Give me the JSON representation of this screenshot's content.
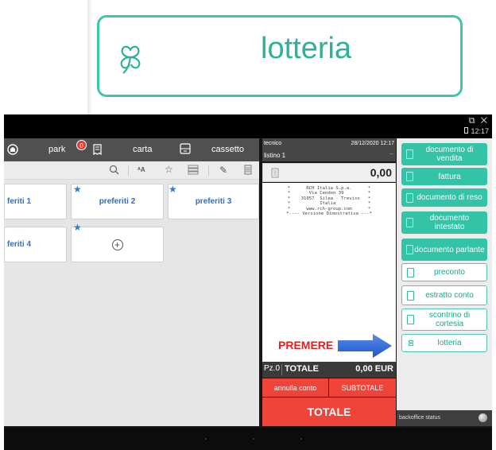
{
  "zoom": {
    "label": "lotteria"
  },
  "topbar": {
    "park": "park",
    "carta": "carta",
    "cassetto": "cassetto",
    "badge": "0"
  },
  "status": {
    "clock": "12:17",
    "window_icons": "⧉ ✕"
  },
  "favorites": [
    {
      "label": "feriti 1",
      "starred": false
    },
    {
      "label": "preferiti 2",
      "starred": true
    },
    {
      "label": "preferiti 3",
      "starred": true
    },
    {
      "label": "feriti 4",
      "starred": false
    }
  ],
  "receipt": {
    "operator": "tecnico",
    "datetime": "28/12/2020 12:17",
    "price_list": "listino 1",
    "dash": "--",
    "amount": "0,00",
    "header_text": "*      RCH Italia S.p.a.      *\n*       Via Cendon 39         *\n*    31057  Silea - Treviso   *\n*           Italia            *\n*      www.rch-group.com      *\n*---- Versione Dimostrativa ---*"
  },
  "annotation": {
    "label": "PREMERE"
  },
  "totals": {
    "pieces": "Pz.0",
    "total_label": "TOTALE",
    "total_value": "0,00 EUR",
    "cancel_label": "annulla conto",
    "subtotal_label": "SUBTOTALE",
    "total_button_label": "TOTALE"
  },
  "actions": [
    {
      "label": "documento di vendita",
      "style": "filled"
    },
    {
      "label": "fattura",
      "style": "filled"
    },
    {
      "label": "documento di reso",
      "style": "filled"
    },
    {
      "label": "documento intestato",
      "style": "filled"
    },
    {
      "label": "documento parlante",
      "style": "filled"
    },
    {
      "label": "preconto",
      "style": "outline"
    },
    {
      "label": "estratto conto",
      "style": "outline"
    },
    {
      "label": "scontrino di cortesia",
      "style": "outline"
    },
    {
      "label": "lotteria",
      "style": "outline"
    }
  ],
  "backoffice": {
    "label": "backoffice status"
  },
  "colors": {
    "accent": "#33c3a6",
    "accent_outline": "#3cc6ae",
    "danger": "#f0433a",
    "favorite_text": "#2b6fc9",
    "arrow": "#2f6fe0"
  },
  "icons": [
    "clover-icon",
    "search-icon",
    "font-size-icon",
    "star-icon",
    "list-icon",
    "pencil-icon",
    "trash-icon",
    "receipt-icon",
    "card-icon",
    "cash-drawer-icon",
    "plus-circle-icon"
  ]
}
